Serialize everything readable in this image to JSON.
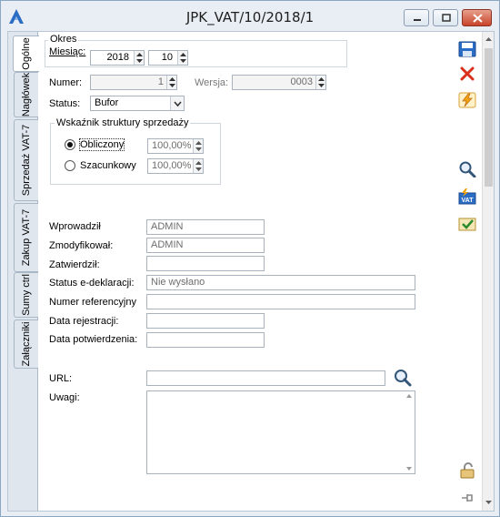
{
  "window": {
    "title": "JPK_VAT/10/2018/1"
  },
  "tabs": [
    {
      "label": "Ogólne",
      "active": true
    },
    {
      "label": "Nagłówek",
      "active": false
    },
    {
      "label": "Sprzedaż VAT-7",
      "active": false
    },
    {
      "label": "Zakup VAT-7",
      "active": false
    },
    {
      "label": "Sumy ctrl",
      "active": false
    },
    {
      "label": "Załączniki",
      "active": false
    }
  ],
  "okres": {
    "legend": "Okres",
    "miesiac_label": "Miesiąc:",
    "year": "2018",
    "month": "10"
  },
  "numer": {
    "label": "Numer:",
    "value": "1"
  },
  "wersja": {
    "label": "Wersja:",
    "value": "0003"
  },
  "status": {
    "label": "Status:",
    "value": "Bufor"
  },
  "wskaznik": {
    "legend": "Wskaźnik struktury sprzedaży",
    "obliczony_label": "Obliczony",
    "obliczony_value": "100,00%",
    "szacunkowy_label": "Szacunkowy",
    "szacunkowy_value": "100,00%",
    "selected": "Obliczony"
  },
  "info": {
    "wprowadzil_label": "Wprowadził",
    "wprowadzil_value": "ADMIN",
    "zmodyfikowal_label": "Zmodyfikował:",
    "zmodyfikowal_value": "ADMIN",
    "zatwierdzil_label": "Zatwierdził:",
    "zatwierdzil_value": "",
    "status_edekl_label": "Status e-deklaracji:",
    "status_edekl_value": "Nie wysłano",
    "numer_ref_label": "Numer referencyjny",
    "numer_ref_value": "",
    "data_rej_label": "Data rejestracji:",
    "data_rej_value": "",
    "data_pot_label": "Data potwierdzenia:",
    "data_pot_value": ""
  },
  "url": {
    "label": "URL:",
    "value": ""
  },
  "uwagi": {
    "label": "Uwagi:",
    "value": ""
  },
  "toolbar": {
    "items": [
      "save-icon",
      "delete-icon",
      "lightning-icon",
      "search-icon",
      "vat-lightning-icon",
      "approve-icon",
      "lock-icon",
      "pin-icon"
    ]
  },
  "colors": {
    "accent": "#2b6cc4",
    "window_bg": "#e9eef4",
    "close_button": "#c8442a"
  }
}
